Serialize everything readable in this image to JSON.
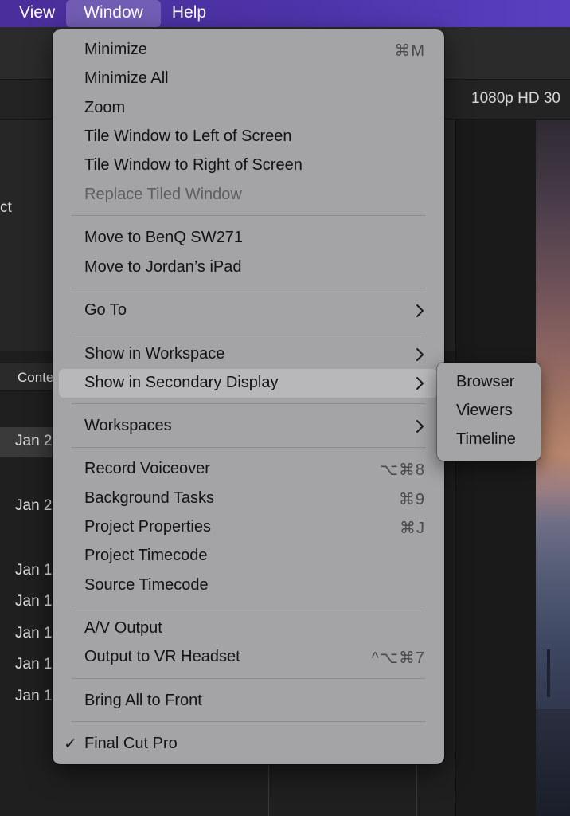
{
  "menubar": {
    "items": [
      {
        "label": "View"
      },
      {
        "label": "Window"
      },
      {
        "label": "Help"
      }
    ]
  },
  "background": {
    "viewer_format": "1080p HD 30",
    "library_text": "ct",
    "column_header": "Conte",
    "row_dates": [
      "Jan 2",
      "Jan 2",
      "Jan 1",
      "Jan 1",
      "Jan 1",
      "Jan 1",
      "Jan 1"
    ]
  },
  "window_menu": {
    "minimize": {
      "label": "Minimize",
      "shortcut": "⌘M"
    },
    "minimize_all": {
      "label": "Minimize All"
    },
    "zoom": {
      "label": "Zoom"
    },
    "tile_left": {
      "label": "Tile Window to Left of Screen"
    },
    "tile_right": {
      "label": "Tile Window to Right of Screen"
    },
    "replace_tiled": {
      "label": "Replace Tiled Window"
    },
    "move_benq": {
      "label": "Move to BenQ SW271"
    },
    "move_ipad": {
      "label": "Move to Jordan’s iPad"
    },
    "go_to": {
      "label": "Go To"
    },
    "show_workspace": {
      "label": "Show in Workspace"
    },
    "show_secondary": {
      "label": "Show in Secondary Display"
    },
    "workspaces": {
      "label": "Workspaces"
    },
    "record_voiceover": {
      "label": "Record Voiceover",
      "shortcut": "⌥⌘8"
    },
    "background_tasks": {
      "label": "Background Tasks",
      "shortcut": "⌘9"
    },
    "project_properties": {
      "label": "Project Properties",
      "shortcut": "⌘J"
    },
    "project_timecode": {
      "label": "Project Timecode"
    },
    "source_timecode": {
      "label": "Source Timecode"
    },
    "av_output": {
      "label": "A/V Output"
    },
    "output_vr": {
      "label": "Output to VR Headset",
      "shortcut": "^⌥⌘7"
    },
    "bring_all": {
      "label": "Bring All to Front"
    },
    "final_cut": {
      "label": "Final Cut Pro",
      "check": "✓"
    }
  },
  "secondary_submenu": {
    "items": [
      {
        "label": "Browser"
      },
      {
        "label": "Viewers"
      },
      {
        "label": "Timeline"
      }
    ]
  },
  "colors": {
    "menubar_accent": "#4d33a8",
    "menu_background": "#a4a4a7",
    "menu_text": "#131313",
    "disabled_text": "#5e5e60"
  }
}
